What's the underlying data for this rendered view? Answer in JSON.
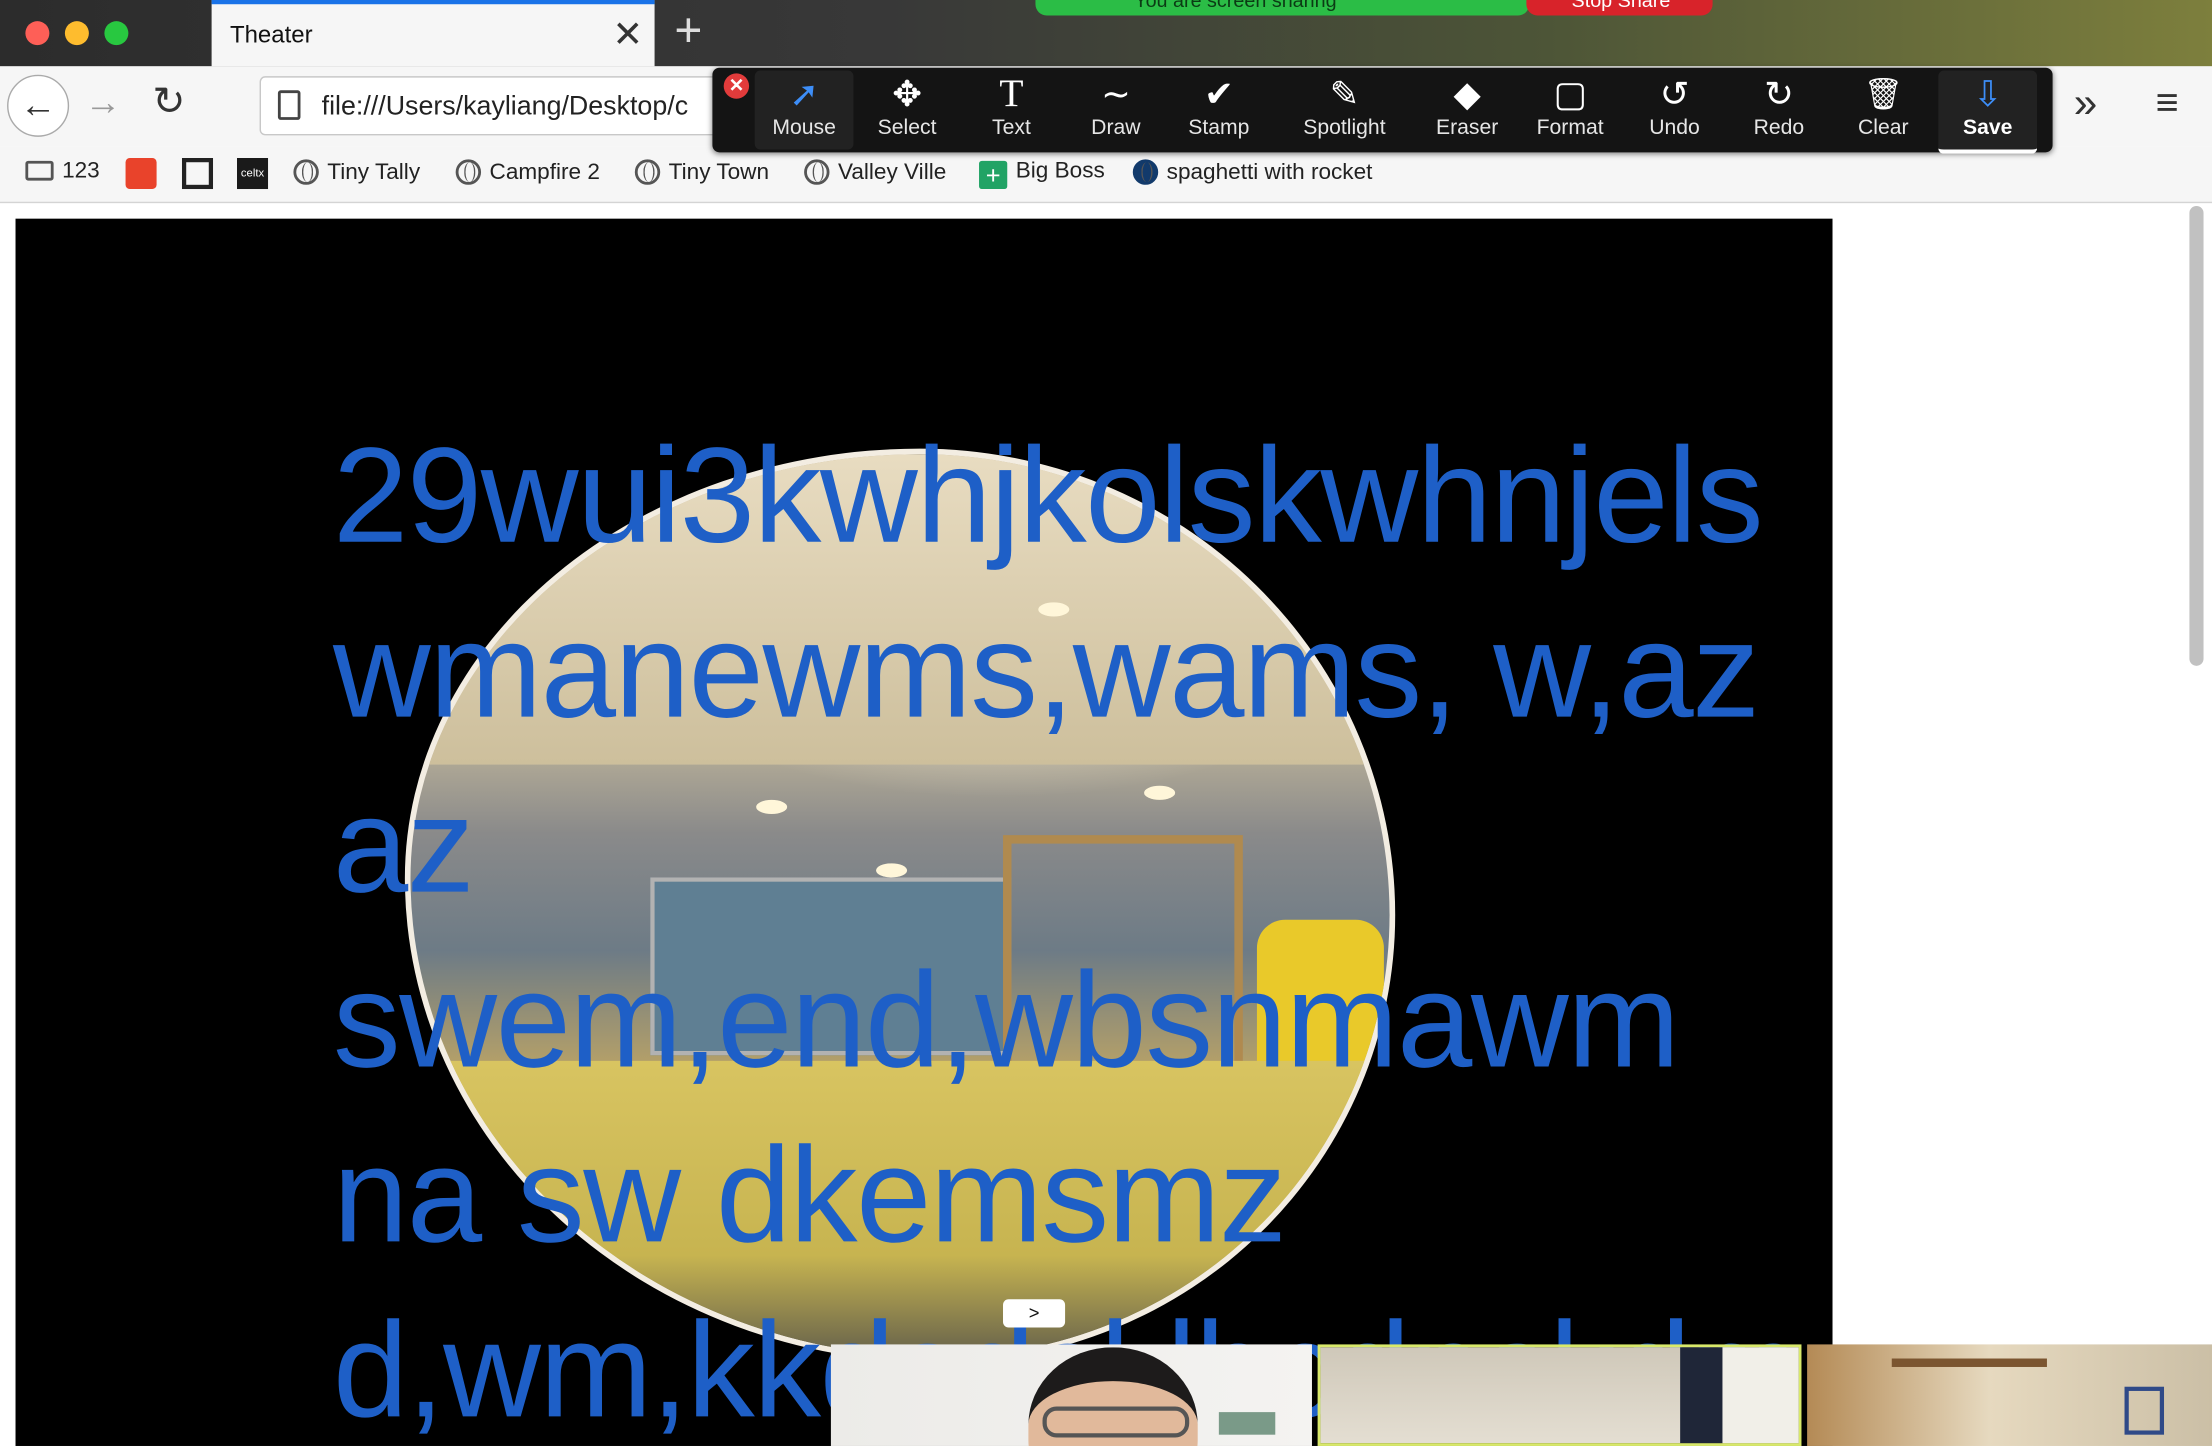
{
  "browser": {
    "tab_title": "Theater",
    "tab_close": "✕",
    "new_tab": "+",
    "url": "file:///Users/kayliang/Desktop/c",
    "nav": {
      "back": "←",
      "forward": "→",
      "reload": "↻",
      "overflow": "»",
      "menu": "≡"
    }
  },
  "screen_share": {
    "banner": "You are screen sharing",
    "stop_label": "Stop Share",
    "banner_color": "#2bbd46",
    "stop_color": "#d8232a"
  },
  "annotate_toolbar": {
    "close": "✕",
    "tools": [
      {
        "label": "Mouse",
        "icon": "cursor-arrow-icon",
        "glyph": "➚"
      },
      {
        "label": "Select",
        "icon": "move-arrows-icon",
        "glyph": "✥"
      },
      {
        "label": "Text",
        "icon": "text-t-icon",
        "glyph": "T"
      },
      {
        "label": "Draw",
        "icon": "squiggle-icon",
        "glyph": "∼"
      },
      {
        "label": "Stamp",
        "icon": "checkmark-icon",
        "glyph": "✔"
      },
      {
        "label": "Spotlight",
        "icon": "magic-wand-icon",
        "glyph": "✎"
      },
      {
        "label": "Eraser",
        "icon": "eraser-icon",
        "glyph": "◆"
      },
      {
        "label": "Format",
        "icon": "rounded-square-icon",
        "glyph": "▢"
      },
      {
        "label": "Undo",
        "icon": "undo-icon",
        "glyph": "↺"
      },
      {
        "label": "Redo",
        "icon": "redo-icon",
        "glyph": "↻"
      },
      {
        "label": "Clear",
        "icon": "trash-icon",
        "glyph": "🗑"
      },
      {
        "label": "Save",
        "icon": "save-download-icon",
        "glyph": "⇩"
      }
    ],
    "active_tool": "Mouse",
    "accent": "#3d8ef8"
  },
  "bookmarks": [
    {
      "label": "123",
      "icon": "folder-icon"
    },
    {
      "label": "",
      "icon": "red-mask-favicon"
    },
    {
      "label": "",
      "icon": "qr-square-favicon"
    },
    {
      "label": "celtx",
      "icon": "celtx-favicon"
    },
    {
      "label": "Tiny Tally",
      "icon": "globe-icon"
    },
    {
      "label": "Campfire 2",
      "icon": "globe-icon"
    },
    {
      "label": "Tiny Town",
      "icon": "globe-icon"
    },
    {
      "label": "Valley Ville",
      "icon": "globe-icon"
    },
    {
      "label": "Big Boss",
      "icon": "sheets-plus-favicon"
    },
    {
      "label": "spaghetti with rocket",
      "icon": "dark-globe-favicon"
    }
  ],
  "stage_text": [
    "29wui3kwhjkolskwhnjels",
    "wmanewms,wams, w,az",
    "az",
    "swem,end,wbsnmawm",
    "na sw dkemsmz",
    "d,wm,kkdsdsklbcdnskdm"
  ],
  "video_strip": {
    "toggle": ">",
    "participants": [
      {
        "name": "participant-1-video"
      },
      {
        "name": "participant-2-video"
      },
      {
        "name": "participant-3-video"
      }
    ]
  },
  "text_color": "#1e5fc7"
}
